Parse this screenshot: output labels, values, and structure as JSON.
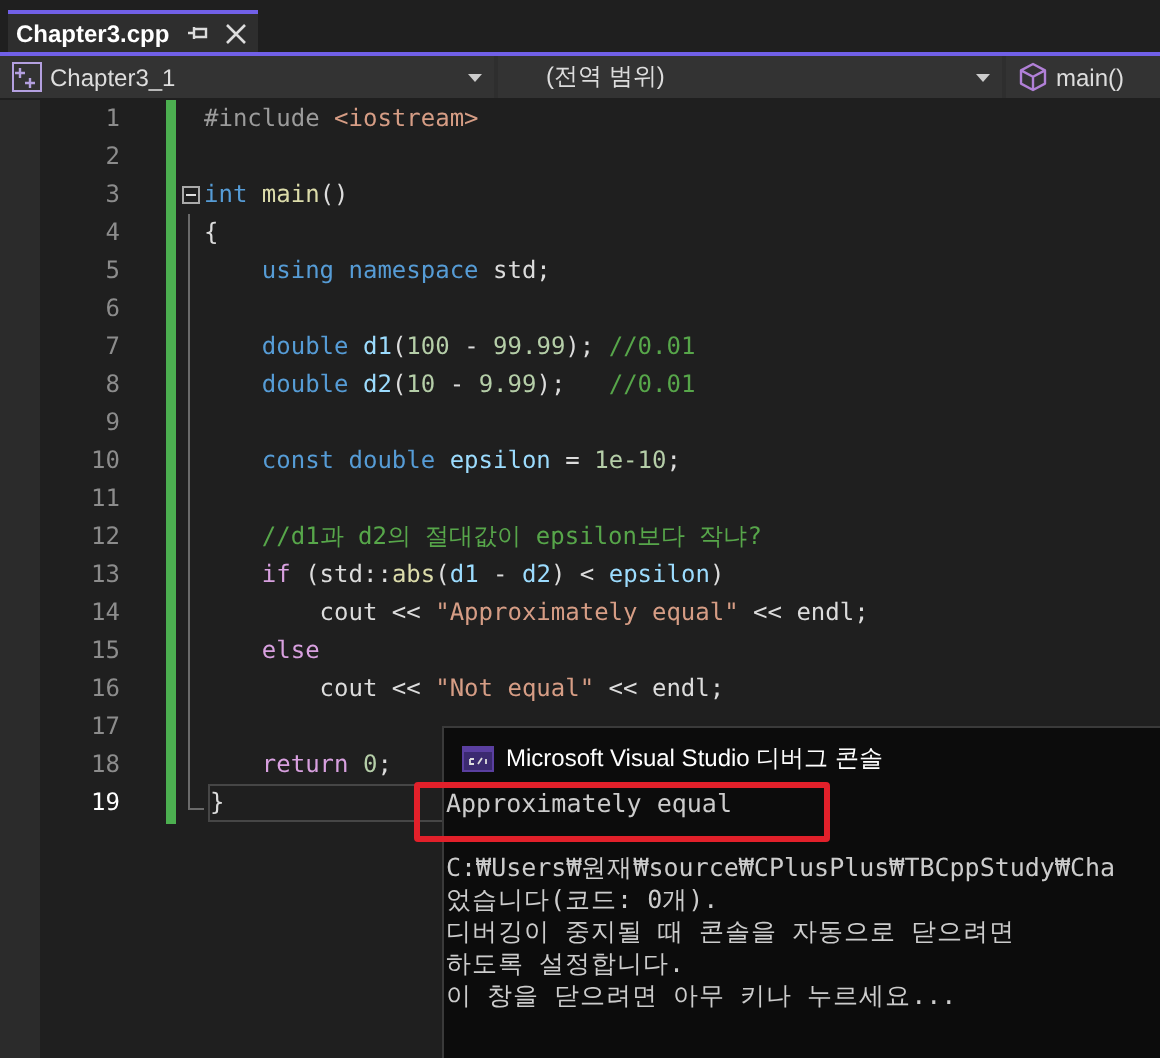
{
  "tabs": [
    {
      "label": "Chapter3.cpp",
      "selected": true
    }
  ],
  "navigation_bar": {
    "project": "Chapter3_1",
    "scope": "(전역 범위)",
    "member": "main()"
  },
  "editor": {
    "lines": [
      {
        "number": "1",
        "current": false,
        "tokens": [
          {
            "kind": "pre",
            "text": "#include "
          },
          {
            "kind": "str",
            "text": "<iostream>"
          }
        ]
      },
      {
        "number": "2",
        "current": false
      },
      {
        "number": "3",
        "current": false,
        "expanded": true,
        "tokens": [
          {
            "kind": "kw",
            "text": "int "
          },
          {
            "kind": "fn",
            "text": "main"
          },
          {
            "kind": "plain",
            "text": "()"
          }
        ]
      },
      {
        "number": "4",
        "current": false,
        "tokens": [
          {
            "kind": "plain",
            "text": "{"
          }
        ]
      },
      {
        "number": "5",
        "current": false,
        "tokens": [
          {
            "kind": "kw",
            "text": "    using namespace"
          },
          {
            "kind": "plain",
            "text": " std;"
          }
        ]
      },
      {
        "number": "6",
        "current": false
      },
      {
        "number": "7",
        "current": false,
        "tokens": [
          {
            "kind": "kw",
            "text": "    double "
          },
          {
            "kind": "var",
            "text": "d1"
          },
          {
            "kind": "plain",
            "text": "("
          },
          {
            "kind": "num",
            "text": "100"
          },
          {
            "kind": "plain",
            "text": " - "
          },
          {
            "kind": "num",
            "text": "99.99"
          },
          {
            "kind": "plain",
            "text": "); "
          },
          {
            "kind": "cmt",
            "text": "//0.01"
          }
        ]
      },
      {
        "number": "8",
        "current": false,
        "tokens": [
          {
            "kind": "kw",
            "text": "    double "
          },
          {
            "kind": "var",
            "text": "d2"
          },
          {
            "kind": "plain",
            "text": "("
          },
          {
            "kind": "num",
            "text": "10"
          },
          {
            "kind": "plain",
            "text": " - "
          },
          {
            "kind": "num",
            "text": "9.99"
          },
          {
            "kind": "plain",
            "text": ");   "
          },
          {
            "kind": "cmt",
            "text": "//0.01"
          }
        ]
      },
      {
        "number": "9",
        "current": false
      },
      {
        "number": "10",
        "current": false,
        "tokens": [
          {
            "kind": "kw",
            "text": "    const double "
          },
          {
            "kind": "var",
            "text": "epsilon"
          },
          {
            "kind": "plain",
            "text": " = "
          },
          {
            "kind": "num",
            "text": "1e-10"
          },
          {
            "kind": "plain",
            "text": ";"
          }
        ]
      },
      {
        "number": "11",
        "current": false
      },
      {
        "number": "12",
        "current": false,
        "tokens": [
          {
            "kind": "cmt",
            "text": "    //d1과 d2의 절대값이 epsilon보다 작냐?"
          }
        ]
      },
      {
        "number": "13",
        "current": false,
        "tokens": [
          {
            "kind": "ctl",
            "text": "    if"
          },
          {
            "kind": "plain",
            "text": " (std::"
          },
          {
            "kind": "fn",
            "text": "abs"
          },
          {
            "kind": "plain",
            "text": "("
          },
          {
            "kind": "var",
            "text": "d1"
          },
          {
            "kind": "plain",
            "text": " - "
          },
          {
            "kind": "var",
            "text": "d2"
          },
          {
            "kind": "plain",
            "text": ") < "
          },
          {
            "kind": "var",
            "text": "epsilon"
          },
          {
            "kind": "plain",
            "text": ")"
          }
        ]
      },
      {
        "number": "14",
        "current": false,
        "tokens": [
          {
            "kind": "plain",
            "text": "        cout << "
          },
          {
            "kind": "str",
            "text": "\"Approximately equal\""
          },
          {
            "kind": "plain",
            "text": " << endl;"
          }
        ]
      },
      {
        "number": "15",
        "current": false,
        "tokens": [
          {
            "kind": "ctl",
            "text": "    else"
          }
        ]
      },
      {
        "number": "16",
        "current": false,
        "tokens": [
          {
            "kind": "plain",
            "text": "        cout << "
          },
          {
            "kind": "str",
            "text": "\"Not equal\""
          },
          {
            "kind": "plain",
            "text": " << endl;"
          }
        ]
      },
      {
        "number": "17",
        "current": false
      },
      {
        "number": "18",
        "current": false,
        "tokens": [
          {
            "kind": "ctl",
            "text": "    return "
          },
          {
            "kind": "num",
            "text": "0"
          },
          {
            "kind": "plain",
            "text": ";"
          }
        ]
      },
      {
        "number": "19",
        "current": true,
        "tokens": [
          {
            "kind": "plain",
            "text": "}"
          }
        ]
      }
    ]
  },
  "console": {
    "title": "Microsoft Visual Studio 디버그 콘솔",
    "output": [
      "Approximately equal",
      "C:₩Users₩원재₩source₩CPlusPlus₩TBCppStudy₩Cha",
      "었습니다(코드: 0개).",
      "디버깅이 중지될 때 콘솔을 자동으로 닫으려면",
      "하도록 설정합니다.",
      "이 창을 닫으려면 아무 키나 누르세요..."
    ]
  }
}
